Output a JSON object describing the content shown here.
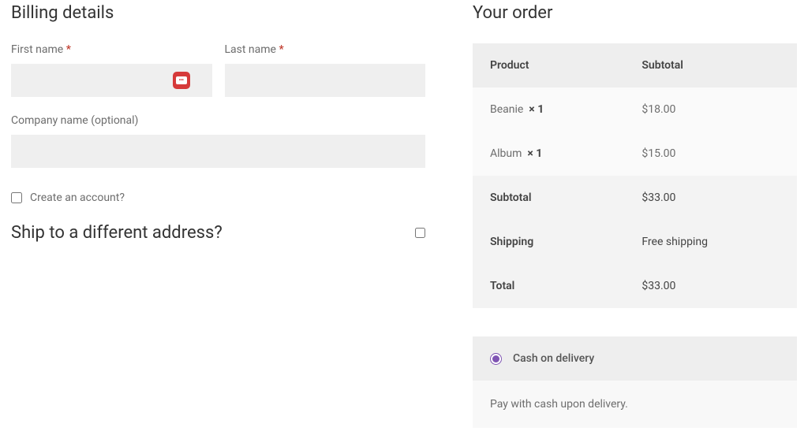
{
  "billing": {
    "title": "Billing details",
    "first_name_label": "First name",
    "last_name_label": "Last name",
    "company_label": "Company name (optional)",
    "required_mark": "*",
    "first_name_value": "",
    "last_name_value": "",
    "company_value": "",
    "create_account_label": "Create an account?"
  },
  "shipping": {
    "title": "Ship to a different address?"
  },
  "order": {
    "title": "Your order",
    "header_product": "Product",
    "header_subtotal": "Subtotal",
    "items": [
      {
        "name": "Beanie",
        "qty_prefix": "×",
        "qty": "1",
        "price": "$18.00"
      },
      {
        "name": "Album",
        "qty_prefix": "×",
        "qty": "1",
        "price": "$15.00"
      }
    ],
    "totals": [
      {
        "label": "Subtotal",
        "value": "$33.00"
      },
      {
        "label": "Shipping",
        "value": "Free shipping"
      },
      {
        "label": "Total",
        "value": "$33.00"
      }
    ]
  },
  "payment": {
    "method_label": "Cash on delivery",
    "description": "Pay with cash upon delivery."
  }
}
